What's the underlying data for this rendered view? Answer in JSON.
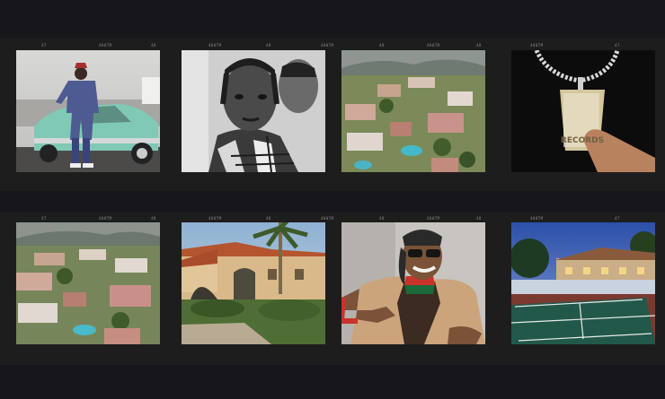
{
  "film": {
    "edge_codes_top": [
      "47",
      "400TM",
      "48",
      "400TM",
      "48",
      "400TM",
      "48",
      "400TM",
      "48",
      "400TM",
      "47"
    ],
    "edge_codes_bottom": [
      "47",
      "400TM",
      "48",
      "400TM",
      "48",
      "400TM",
      "48",
      "400TM",
      "48",
      "400TM",
      "47"
    ]
  },
  "frames": [
    {
      "subject": "man-by-vintage-car"
    },
    {
      "subject": "bw-portrait"
    },
    {
      "subject": "aerial-neighborhood"
    },
    {
      "subject": "pendant-chain",
      "pendant_text": "RECORDS"
    },
    {
      "subject": "aerial-neighborhood-2"
    },
    {
      "subject": "villa-with-palm"
    },
    {
      "subject": "smiling-man-sunglasses"
    },
    {
      "subject": "mansion-tennis-court"
    }
  ],
  "colors": {
    "background": "#17161a",
    "strip": "#1d1d1d"
  }
}
